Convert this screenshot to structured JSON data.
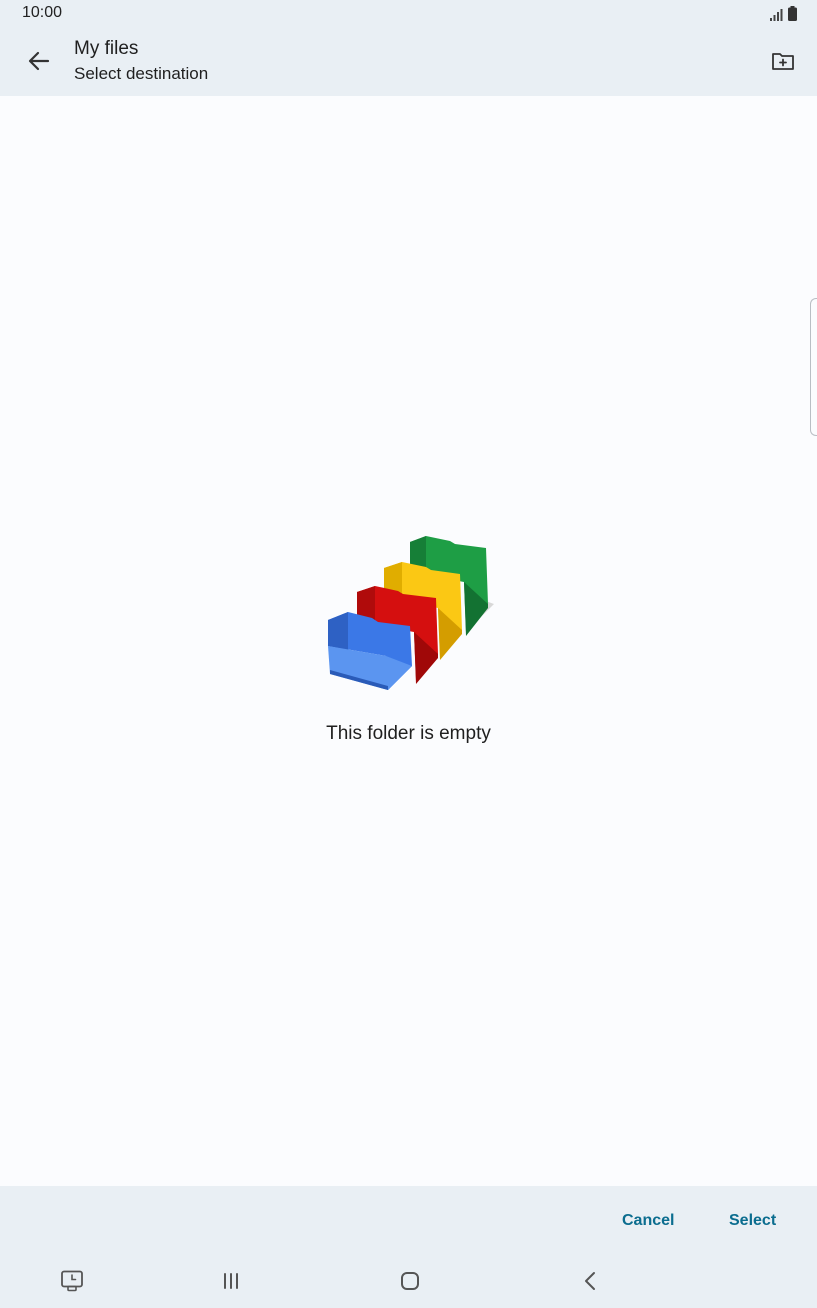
{
  "status_bar": {
    "time": "10:00",
    "icons": [
      "signal-icon",
      "battery-icon"
    ]
  },
  "app_bar": {
    "title": "My files",
    "subtitle": "Select destination",
    "back_icon": "arrow-back-icon",
    "new_folder_icon": "create-folder-icon"
  },
  "content": {
    "empty_message": "This folder is empty",
    "illustration_icon": "empty-folders-illustration",
    "illustration_colors": [
      "#3b78e7",
      "#d50f0f",
      "#fbc814",
      "#1e9e45"
    ]
  },
  "actions": {
    "cancel_label": "Cancel",
    "select_label": "Select",
    "accent_color": "#0b6d8f"
  },
  "nav_bar": {
    "icons": [
      "screen-recorder-icon",
      "recent-apps-icon",
      "home-icon",
      "back-icon"
    ]
  }
}
